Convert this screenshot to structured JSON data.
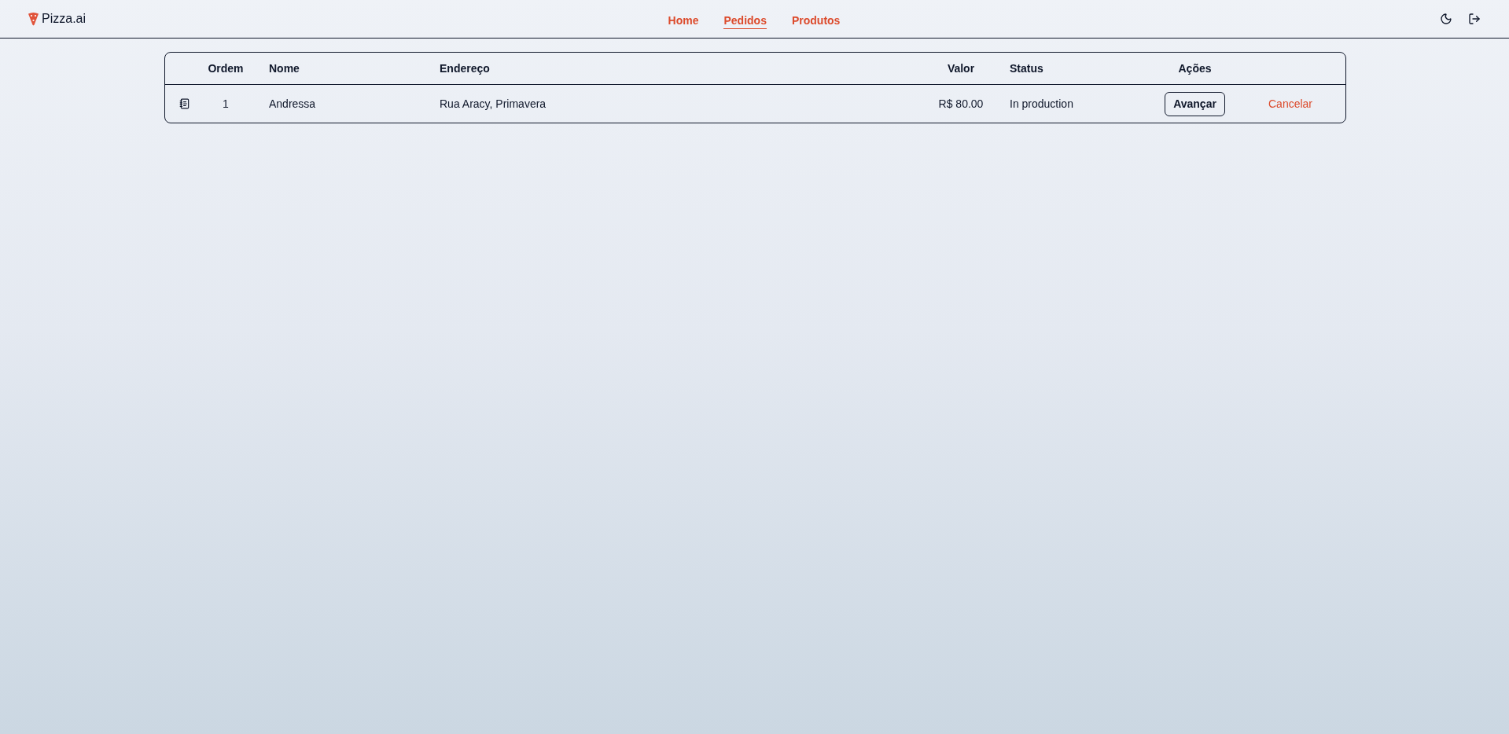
{
  "brand": {
    "name": "Pizza.ai"
  },
  "nav": [
    {
      "label": "Home",
      "selected": false
    },
    {
      "label": "Pedidos",
      "selected": true
    },
    {
      "label": "Produtos",
      "selected": false
    }
  ],
  "table": {
    "columns": [
      "Ordem",
      "Nome",
      "Endereço",
      "Valor",
      "Status",
      "Ações"
    ],
    "rows": [
      {
        "order": "1",
        "name": "Andressa",
        "address": "Rua Aracy, Primavera",
        "value": "R$ 80.00",
        "status": "In production",
        "actions": [
          {
            "label": "Avançar",
            "kind": "outline"
          },
          {
            "label": "Cancelar",
            "kind": "danger"
          }
        ]
      }
    ]
  }
}
